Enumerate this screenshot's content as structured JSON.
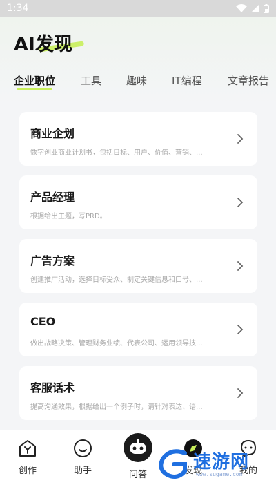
{
  "status_bar": {
    "time": "1:34"
  },
  "header": {
    "title": "AI发现"
  },
  "tabs": [
    {
      "label": "企业职位",
      "active": true
    },
    {
      "label": "工具",
      "active": false
    },
    {
      "label": "趣味",
      "active": false
    },
    {
      "label": "IT编程",
      "active": false
    },
    {
      "label": "文章报告",
      "active": false
    }
  ],
  "cards": [
    {
      "title": "商业企划",
      "desc": "数字创业商业计划书，包括目标、用户、价值、营销、..."
    },
    {
      "title": "产品经理",
      "desc": "根据给出主题，写PRD。"
    },
    {
      "title": "广告方案",
      "desc": "创建推广活动，选择目标受众、制定关键信息和口号、..."
    },
    {
      "title": "CEO",
      "desc": "做出战略决策、管理财务业绩、代表公司、运用领导技..."
    },
    {
      "title": "客服话术",
      "desc": "提高沟通效果，根据给出一个例子时，请针对表达、语..."
    }
  ],
  "bottom_nav": [
    {
      "label": "创作"
    },
    {
      "label": "助手"
    },
    {
      "label": "问答"
    },
    {
      "label": "发现"
    },
    {
      "label": "我的"
    }
  ],
  "watermark": {
    "text": "速游网",
    "sub": "www.sugame.com"
  },
  "colors": {
    "accent": "#c8ef5a",
    "background": "#f4f5f7",
    "card": "#ffffff"
  }
}
